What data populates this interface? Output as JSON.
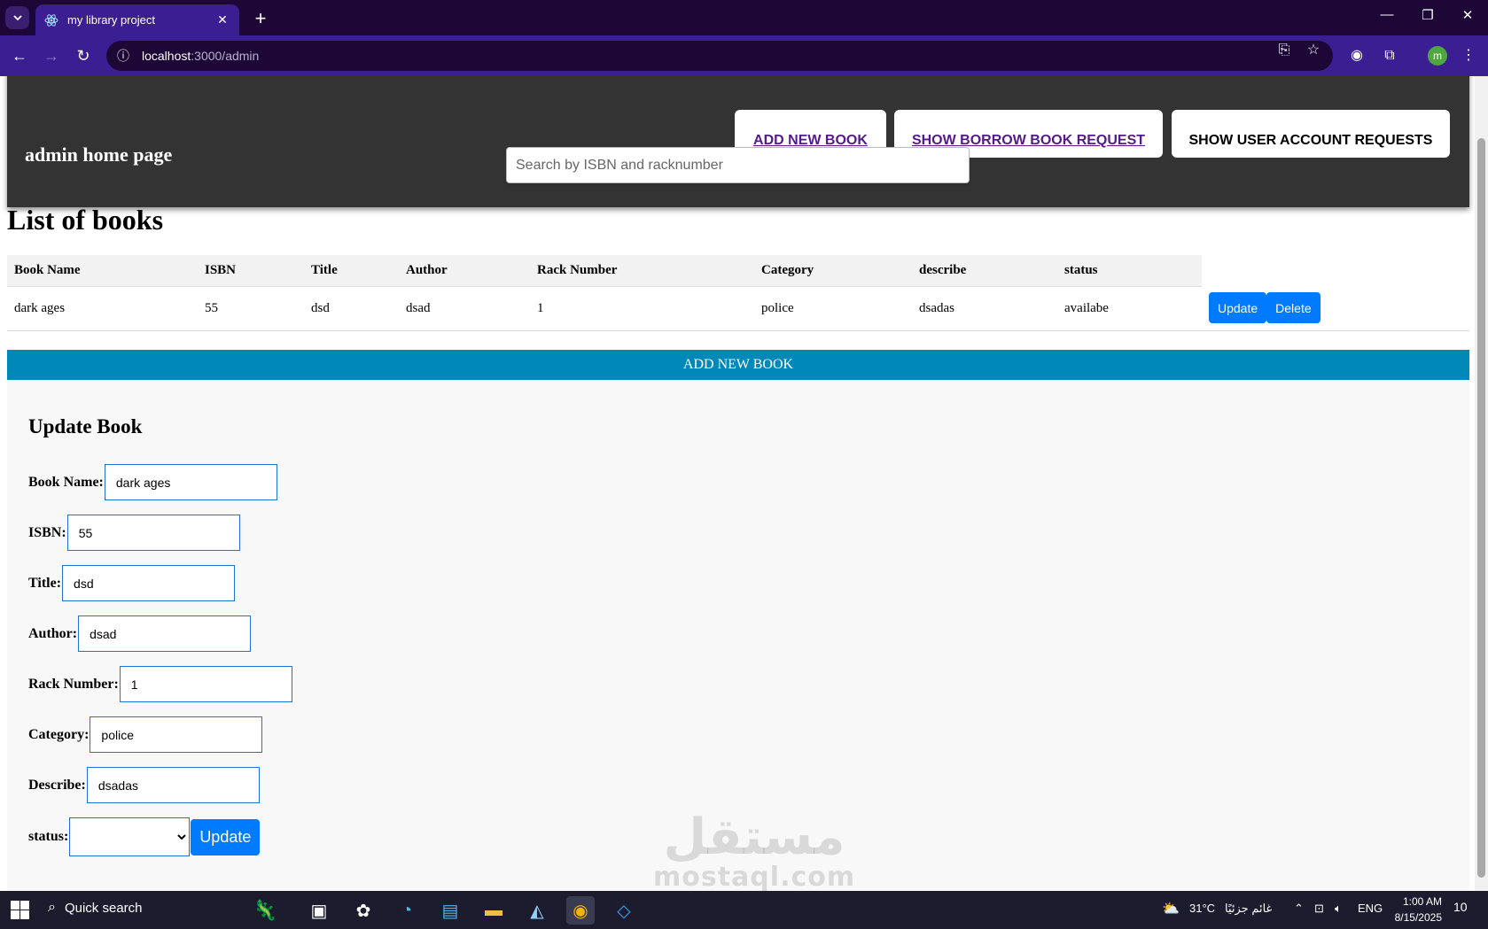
{
  "browser": {
    "tab_title": "my library project",
    "url_host": "localhost",
    "url_path": ":3000/admin"
  },
  "header": {
    "title": "admin home page",
    "add_book_link": "ADD NEW BOOK",
    "borrow_requests_link": "SHOW BORROW BOOK REQUEST",
    "account_requests_button": "SHOW USER ACCOUNT REQUESTS"
  },
  "search": {
    "placeholder": "Search by ISBN and racknumber"
  },
  "list": {
    "title": "List of books",
    "columns": [
      "Book Name",
      "ISBN",
      "Title",
      "Author",
      "Rack Number",
      "Category",
      "describe",
      "status"
    ],
    "rows": [
      {
        "book_name": "dark ages",
        "isbn": "55",
        "title": "dsd",
        "author": "dsad",
        "rack_number": "1",
        "category": "police",
        "describe": "dsadas",
        "status": "availabe",
        "update_label": "Update",
        "delete_label": "Delete"
      }
    ]
  },
  "add_bar_label": "ADD NEW BOOK",
  "form": {
    "title": "Update Book",
    "book_name_label": "Book Name:",
    "book_name_value": "dark ages",
    "isbn_label": "ISBN:",
    "isbn_value": "55",
    "title_label": "Title:",
    "title_value": "dsd",
    "author_label": "Author:",
    "author_value": "dsad",
    "rack_label": "Rack Number:",
    "rack_value": "1",
    "category_label": "Category:",
    "category_value": "police",
    "describe_label": "Describe:",
    "describe_value": "dsadas",
    "status_label": "status:",
    "status_value": "",
    "submit_label": "Update"
  },
  "watermark": {
    "arabic": "مستقل",
    "latin": "mostaql.com"
  },
  "taskbar": {
    "search_label": "Quick search",
    "weather": "31°C",
    "weather_text": "غائم جزئيًا",
    "language": "ENG",
    "time": "1:00 AM",
    "date": "8/15/2025",
    "notifications": "10"
  },
  "profile_initial": "m",
  "colors": {
    "browser_dark": "#1d0736",
    "browser_toolbar": "#3b1f92",
    "header_bg": "#333333",
    "add_bar": "#0088b9",
    "primary_button": "#007bff"
  }
}
